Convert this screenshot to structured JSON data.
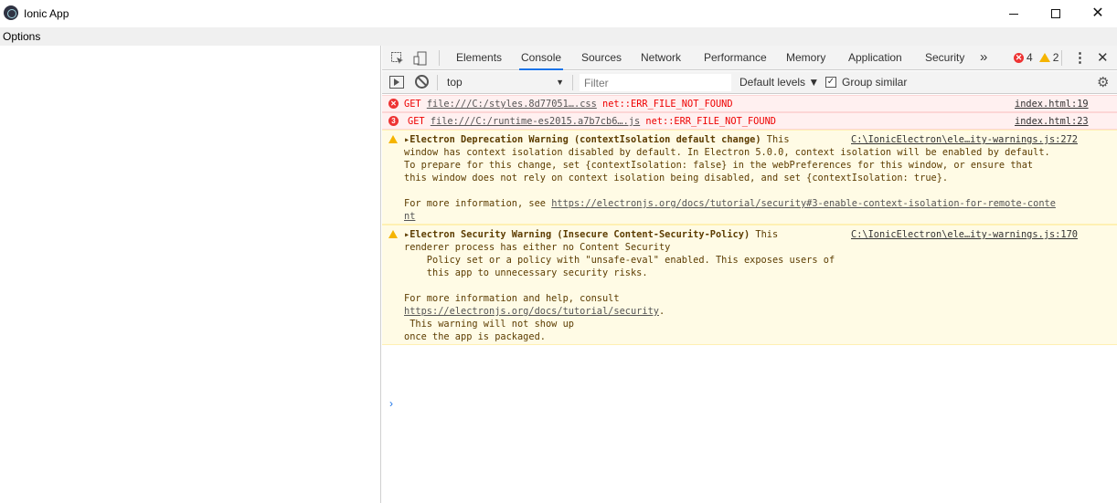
{
  "window": {
    "title": "Ionic App",
    "menu": [
      "Options"
    ]
  },
  "devtools": {
    "tabs": [
      "Elements",
      "Console",
      "Sources",
      "Network",
      "Performance",
      "Memory",
      "Application",
      "Security"
    ],
    "active_tab": "Console",
    "more_tabs": "»",
    "error_count": "4",
    "warning_count": "2",
    "toolbar": {
      "context": "top",
      "filter_placeholder": "Filter",
      "levels": "Default levels ▼",
      "group_similar": "Group similar"
    }
  },
  "console": {
    "messages": [
      {
        "level": "error",
        "icon_label": "✕",
        "method": "GET",
        "url": "file:///C:/styles.8d77051….css",
        "error": "net::ERR_FILE_NOT_FOUND",
        "source": "index.html:19"
      },
      {
        "level": "error",
        "icon_label": "3",
        "method": "GET",
        "url": "file:///C:/runtime-es2015.a7b7cb6….js",
        "error": "net::ERR_FILE_NOT_FOUND",
        "source": "index.html:23"
      },
      {
        "level": "warning",
        "heading": "Electron Deprecation Warning (contextIsolation default change)",
        "line1_tail": " This",
        "lines": [
          "window has context isolation disabled by default. In Electron 5.0.0, context isolation will be enabled by default.",
          "To prepare for this change, set {contextIsolation: false} in the webPreferences for this window, or ensure that",
          "this window does not rely on context isolation being disabled, and set {contextIsolation: true}.",
          "",
          "For more information, see "
        ],
        "link_part1": "https://electronjs.org/docs/tutorial/security#3-enable-context-isolation-for-remote-conte",
        "link_part2": "nt",
        "source": "C:\\IonicElectron\\ele…ity-warnings.js:272"
      },
      {
        "level": "warning",
        "heading": "Electron Security Warning (Insecure Content-Security-Policy)",
        "line1_tail": " This",
        "lines": [
          "renderer process has either no Content Security",
          "    Policy set or a policy with \"unsafe-eval\" enabled. This exposes users of",
          "    this app to unnecessary security risks.",
          "",
          "For more information and help, consult"
        ],
        "link": "https://electronjs.org/docs/tutorial/security",
        "link_tail": ".",
        "tail_lines": [
          " This warning will not show up",
          "once the app is packaged."
        ],
        "source": "C:\\IonicElectron\\ele…ity-warnings.js:170"
      }
    ],
    "prompt": "›"
  }
}
